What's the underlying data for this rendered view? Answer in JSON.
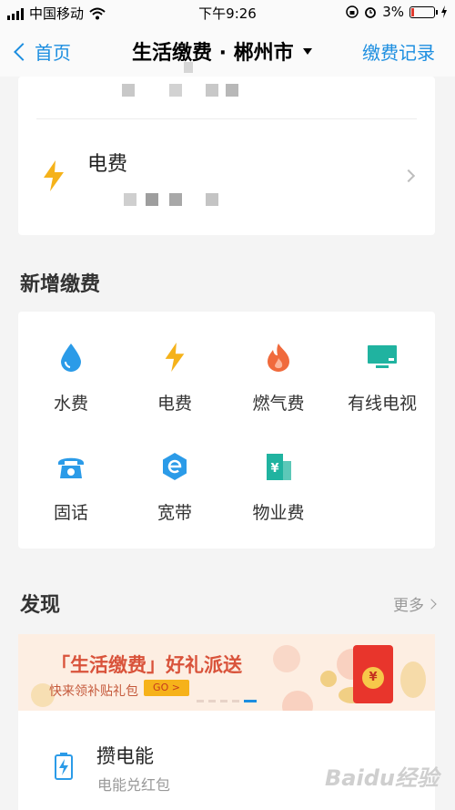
{
  "status_bar": {
    "carrier": "中国移动",
    "time": "下午9:26",
    "battery": "3%"
  },
  "nav": {
    "back_label": "首页",
    "title": "生活缴费 · 郴州市",
    "right_label": "缴费记录"
  },
  "bill": {
    "name": "电费"
  },
  "new_payment": {
    "title": "新增缴费",
    "items": [
      {
        "label": "水费",
        "icon": "water-drop-icon"
      },
      {
        "label": "电费",
        "icon": "lightning-icon"
      },
      {
        "label": "燃气费",
        "icon": "flame-icon"
      },
      {
        "label": "有线电视",
        "icon": "tv-icon"
      },
      {
        "label": "固话",
        "icon": "telephone-icon"
      },
      {
        "label": "宽带",
        "icon": "broadband-icon"
      },
      {
        "label": "物业费",
        "icon": "building-icon"
      }
    ]
  },
  "discover": {
    "title": "发现",
    "more_label": "更多",
    "banner": {
      "title": "「生活缴费」好礼派送",
      "subtitle": "快来领补贴礼包",
      "button": "GO >"
    },
    "promo": {
      "title": "攒电能",
      "subtitle": "电能兑红包"
    }
  },
  "watermark": "Baidu经验",
  "colors": {
    "accent": "#1c8ee0",
    "water": "#2b9be8",
    "lightning": "#f5b21a",
    "flame": "#f06a3c",
    "tv": "#20b3a0",
    "banner_bg": "#fdeee2",
    "banner_red": "#d9533b"
  }
}
